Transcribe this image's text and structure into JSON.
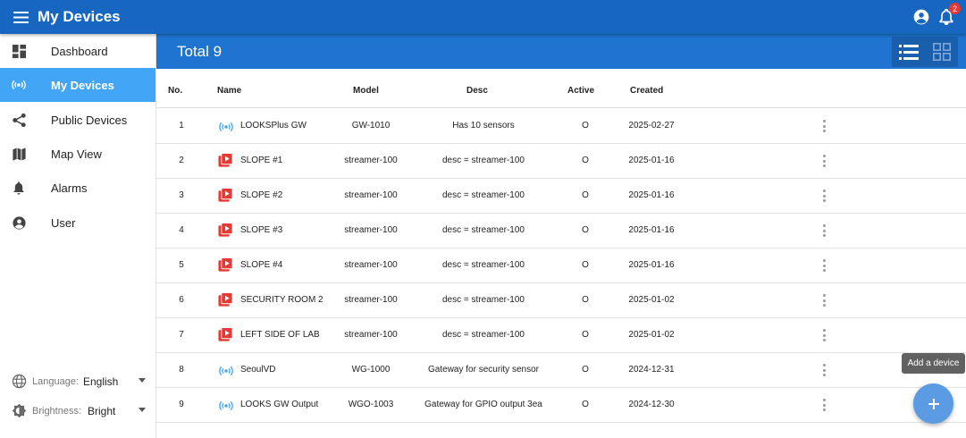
{
  "header": {
    "title": "My Devices",
    "menu_icon": "hamburger-menu-icon",
    "account_icon": "account-circle-icon",
    "notification_icon": "bell-icon",
    "notification_count": "2",
    "color": "#1767c1"
  },
  "sidebar": {
    "items": [
      {
        "label": "Dashboard",
        "icon": "dashboard-icon"
      },
      {
        "label": "My Devices",
        "icon": "radio-tower-icon",
        "active": true
      },
      {
        "label": "Public Devices",
        "icon": "share-icon"
      },
      {
        "label": "Map View",
        "icon": "map-icon"
      },
      {
        "label": "Alarms",
        "icon": "bell-icon"
      },
      {
        "label": "User",
        "icon": "account-circle-icon"
      }
    ],
    "language_label": "Language:",
    "language_value": "English",
    "brightness_label": "Brightness:",
    "brightness_value": "Bright",
    "active_color": "#42a5f5"
  },
  "main": {
    "total_label": "Total 9",
    "view_modes": [
      "list-view-icon",
      "grid-view-icon"
    ],
    "columns": {
      "no": "No.",
      "name": "Name",
      "model": "Model",
      "desc": "Desc",
      "active": "Active",
      "created": "Created"
    },
    "rows": [
      {
        "no": "1",
        "type": "gateway",
        "name": "LOOKSPlus GW",
        "model": "GW-1010",
        "desc": "Has 10 sensors",
        "active": "O",
        "created": "2025-02-27"
      },
      {
        "no": "2",
        "type": "streamer",
        "name": "SLOPE #1",
        "model": "streamer-100",
        "desc": "desc = streamer-100",
        "active": "O",
        "created": "2025-01-16"
      },
      {
        "no": "3",
        "type": "streamer",
        "name": "SLOPE #2",
        "model": "streamer-100",
        "desc": "desc = streamer-100",
        "active": "O",
        "created": "2025-01-16"
      },
      {
        "no": "4",
        "type": "streamer",
        "name": "SLOPE #3",
        "model": "streamer-100",
        "desc": "desc = streamer-100",
        "active": "O",
        "created": "2025-01-16"
      },
      {
        "no": "5",
        "type": "streamer",
        "name": "SLOPE #4",
        "model": "streamer-100",
        "desc": "desc = streamer-100",
        "active": "O",
        "created": "2025-01-16"
      },
      {
        "no": "6",
        "type": "streamer",
        "name": "SECURITY ROOM 2",
        "model": "streamer-100",
        "desc": "desc = streamer-100",
        "active": "O",
        "created": "2025-01-02"
      },
      {
        "no": "7",
        "type": "streamer",
        "name": "LEFT SIDE OF LAB",
        "model": "streamer-100",
        "desc": "desc = streamer-100",
        "active": "O",
        "created": "2025-01-02"
      },
      {
        "no": "8",
        "type": "gateway",
        "name": "SeoulVD",
        "model": "WG-1000",
        "desc": "Gateway for security sensor",
        "active": "O",
        "created": "2024-12-31"
      },
      {
        "no": "9",
        "type": "gateway",
        "name": "LOOKS GW Output",
        "model": "WGO-1003",
        "desc": "Gateway for GPIO output 3ea",
        "active": "O",
        "created": "2024-12-30"
      }
    ],
    "gateway_color": "#42a5f5",
    "streamer_color": "#e53935"
  },
  "fab": {
    "tooltip": "Add a device",
    "icon": "plus-icon"
  }
}
